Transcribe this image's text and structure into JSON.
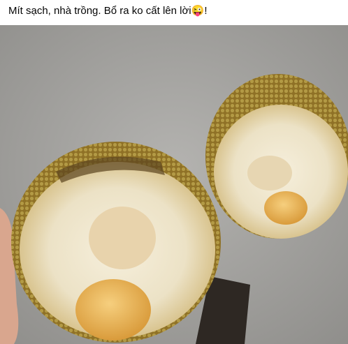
{
  "post": {
    "caption_text": "Mít sạch, nhà trồng. Bổ ra ko cất lên lời",
    "caption_emoji": "😜",
    "caption_end": "!"
  },
  "photo": {
    "icon": "photo-of-two-halved-jackfruits",
    "colors": {
      "concrete": "#a9a8a5",
      "rind": "#9a7c2c",
      "flesh": "#f1e9d3",
      "core": "#e8d3ac",
      "seed": "#eab659"
    }
  }
}
